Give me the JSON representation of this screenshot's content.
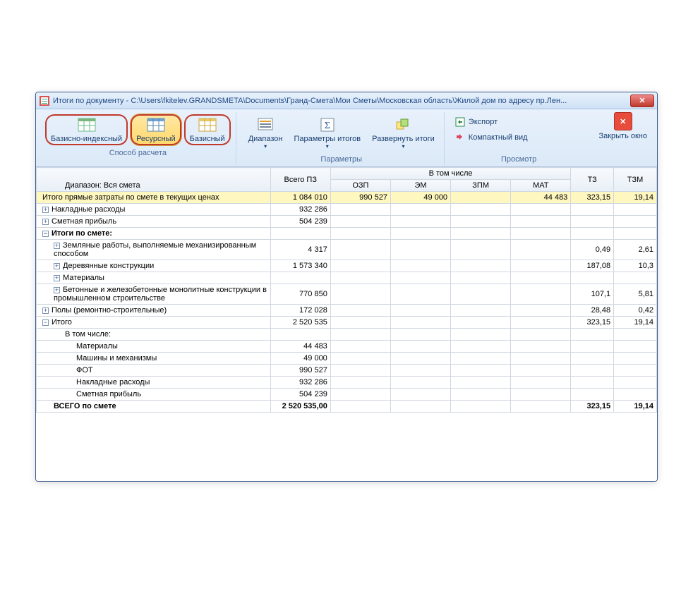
{
  "window": {
    "title": "Итоги по документу - C:\\Users\\fkitelev.GRANDSMETA\\Documents\\Гранд-Смета\\Мои Сметы\\Московская область\\Жилой дом по адресу пр.Лен..."
  },
  "ribbon": {
    "group_calc": {
      "label": "Способ расчета",
      "buttons": {
        "base_index": "Базисно-индексный",
        "resource": "Ресурсный",
        "base": "Базисный"
      }
    },
    "group_params": {
      "label": "Параметры",
      "buttons": {
        "range": "Диапазон",
        "itog_params": "Параметры итогов",
        "expand": "Развернуть итоги"
      }
    },
    "group_view": {
      "label": "Просмотр",
      "export": "Экспорт",
      "compact": "Компактный вид"
    },
    "close": {
      "label": "Закрыть окно"
    }
  },
  "grid": {
    "header": {
      "range_label": "Диапазон: Вся смета",
      "vsego_pz": "Всего ПЗ",
      "v_tom_chisle": "В том числе",
      "ozp": "ОЗП",
      "em": "ЭМ",
      "zpm": "ЗПМ",
      "mat": "МАТ",
      "tz": "ТЗ",
      "tzm": "ТЗМ"
    },
    "rows": [
      {
        "kind": "highlight",
        "indent": 0,
        "toggle": "",
        "label": "Итого прямые затраты по смете в текущих ценах",
        "pz": "1 084 010",
        "ozp": "990 527",
        "em": "49 000",
        "zpm": "",
        "mat": "44 483",
        "tz": "323,15",
        "tzm": "19,14"
      },
      {
        "kind": "",
        "indent": 0,
        "toggle": "+",
        "label": "Накладные расходы",
        "pz": "932 286",
        "ozp": "",
        "em": "",
        "zpm": "",
        "mat": "",
        "tz": "",
        "tzm": ""
      },
      {
        "kind": "",
        "indent": 0,
        "toggle": "+",
        "label": "Сметная прибыль",
        "pz": "504 239",
        "ozp": "",
        "em": "",
        "zpm": "",
        "mat": "",
        "tz": "",
        "tzm": ""
      },
      {
        "kind": "bold",
        "indent": 0,
        "toggle": "-",
        "label": "Итоги по смете:",
        "pz": "",
        "ozp": "",
        "em": "",
        "zpm": "",
        "mat": "",
        "tz": "",
        "tzm": ""
      },
      {
        "kind": "",
        "indent": 1,
        "toggle": "+",
        "label": "Земляные работы, выполняемые механизированным способом",
        "pz": "4 317",
        "ozp": "",
        "em": "",
        "zpm": "",
        "mat": "",
        "tz": "0,49",
        "tzm": "2,61"
      },
      {
        "kind": "",
        "indent": 1,
        "toggle": "+",
        "label": "Деревянные конструкции",
        "pz": "1 573 340",
        "ozp": "",
        "em": "",
        "zpm": "",
        "mat": "",
        "tz": "187,08",
        "tzm": "10,3"
      },
      {
        "kind": "",
        "indent": 1,
        "toggle": "+",
        "label": "Материалы",
        "pz": "",
        "ozp": "",
        "em": "",
        "zpm": "",
        "mat": "",
        "tz": "",
        "tzm": ""
      },
      {
        "kind": "",
        "indent": 1,
        "toggle": "+",
        "label": "Бетонные и железобетонные монолитные конструкции в промышленном строительстве",
        "pz": "770 850",
        "ozp": "",
        "em": "",
        "zpm": "",
        "mat": "",
        "tz": "107,1",
        "tzm": "5,81"
      },
      {
        "kind": "",
        "indent": 0,
        "toggle": "+",
        "label": "Полы (ремонтно-строительные)",
        "pz": "172 028",
        "ozp": "",
        "em": "",
        "zpm": "",
        "mat": "",
        "tz": "28,48",
        "tzm": "0,42"
      },
      {
        "kind": "",
        "indent": 0,
        "toggle": "-",
        "label": "Итого",
        "pz": "2 520 535",
        "ozp": "",
        "em": "",
        "zpm": "",
        "mat": "",
        "tz": "323,15",
        "tzm": "19,14"
      },
      {
        "kind": "",
        "indent": 2,
        "toggle": "",
        "label": "В том числе:",
        "pz": "",
        "ozp": "",
        "em": "",
        "zpm": "",
        "mat": "",
        "tz": "",
        "tzm": ""
      },
      {
        "kind": "",
        "indent": 3,
        "toggle": "",
        "label": "Материалы",
        "pz": "44 483",
        "ozp": "",
        "em": "",
        "zpm": "",
        "mat": "",
        "tz": "",
        "tzm": ""
      },
      {
        "kind": "",
        "indent": 3,
        "toggle": "",
        "label": "Машины и механизмы",
        "pz": "49 000",
        "ozp": "",
        "em": "",
        "zpm": "",
        "mat": "",
        "tz": "",
        "tzm": ""
      },
      {
        "kind": "",
        "indent": 3,
        "toggle": "",
        "label": "ФОТ",
        "pz": "990 527",
        "ozp": "",
        "em": "",
        "zpm": "",
        "mat": "",
        "tz": "",
        "tzm": ""
      },
      {
        "kind": "",
        "indent": 3,
        "toggle": "",
        "label": "Накладные расходы",
        "pz": "932 286",
        "ozp": "",
        "em": "",
        "zpm": "",
        "mat": "",
        "tz": "",
        "tzm": ""
      },
      {
        "kind": "",
        "indent": 3,
        "toggle": "",
        "label": "Сметная прибыль",
        "pz": "504 239",
        "ozp": "",
        "em": "",
        "zpm": "",
        "mat": "",
        "tz": "",
        "tzm": ""
      },
      {
        "kind": "bold",
        "indent": 1,
        "toggle": "",
        "label": "ВСЕГО по смете",
        "pz": "2 520 535,00",
        "ozp": "",
        "em": "",
        "zpm": "",
        "mat": "",
        "tz": "323,15",
        "tzm": "19,14"
      }
    ]
  }
}
